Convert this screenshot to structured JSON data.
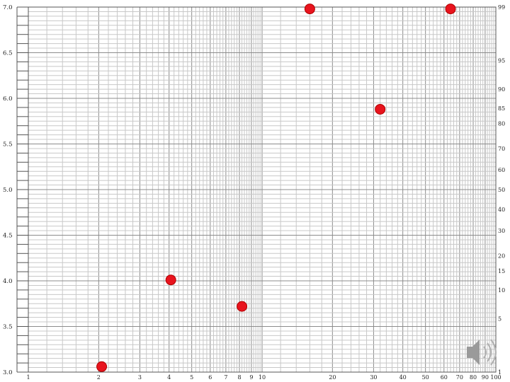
{
  "chart_data": {
    "type": "scatter",
    "x_scale": "log",
    "xlim": [
      1,
      100
    ],
    "ylim": [
      3.0,
      7.0
    ],
    "x_ticks": [
      "1",
      "2",
      "3",
      "4",
      "5",
      "6",
      "7",
      "8",
      "9",
      "10",
      "20",
      "30",
      "40",
      "50",
      "60",
      "70",
      "80",
      "90",
      "100"
    ],
    "y_ticks": [
      "3.0",
      "3.5",
      "4.0",
      "4.5",
      "5.0",
      "5.5",
      "6.0",
      "6.5",
      "7.0"
    ],
    "right_ticks": [
      "1",
      "5",
      "10",
      "15",
      "20",
      "30",
      "40",
      "50",
      "60",
      "70",
      "80",
      "85",
      "90",
      "95",
      "99"
    ],
    "points": [
      {
        "x": 2.06,
        "y": 3.06
      },
      {
        "x": 4.07,
        "y": 4.01
      },
      {
        "x": 8.2,
        "y": 3.72
      },
      {
        "x": 16.0,
        "y": 6.98
      },
      {
        "x": 32.0,
        "y": 5.88
      },
      {
        "x": 64.0,
        "y": 6.98
      }
    ],
    "grid": true,
    "marker_color": "#e8141e"
  },
  "speaker_icon": "speaker-icon"
}
